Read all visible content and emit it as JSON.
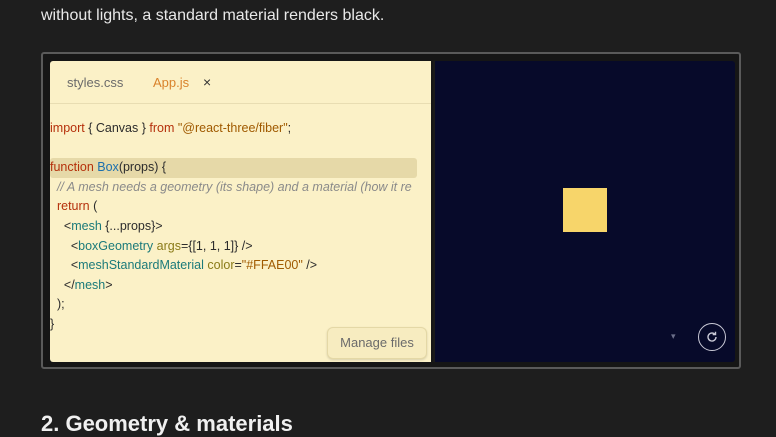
{
  "intro": {
    "line": "without lights, a standard material renders black."
  },
  "editor": {
    "tabs": [
      {
        "label": "styles.css",
        "active": false
      },
      {
        "label": "App.js",
        "active": true
      }
    ],
    "close_symbol": "×",
    "code_lines": [
      "",
      "import { Canvas } from \"@react-three/fiber\";",
      "",
      "function Box(props) {",
      "  // A mesh needs a geometry (its shape) and a material (how it re",
      "  return (",
      "    <mesh {...props}>",
      "      <boxGeometry args={[1, 1, 1]} />",
      "      <meshStandardMaterial color=\"#FFAE00\" />",
      "    </mesh>",
      "  );",
      "}"
    ],
    "manage_files_label": "Manage files"
  },
  "preview": {
    "cube_color": "#F7D56A",
    "dropdown_glyph": "▾"
  },
  "section_heading": "2. Geometry & materials"
}
